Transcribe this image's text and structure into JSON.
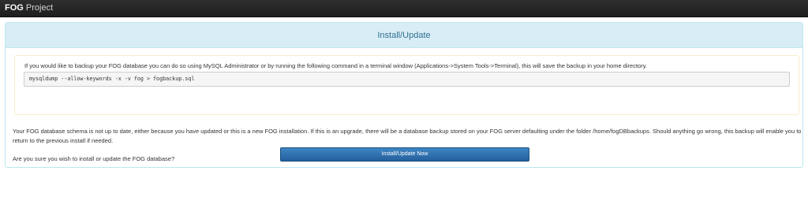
{
  "app": {
    "brand_bold": "FOG",
    "brand_rest": " Project"
  },
  "panel": {
    "title": "Install/Update",
    "backup_notice": "If you would like to backup your FOG database you can do so using MySQL Administrator or by running the following command in a terminal window (Applications->System Tools->Terminal), this will save the backup in your home directory.",
    "backup_command": "mysqldump --allow-keywords -x -v fog > fogbackup.sql",
    "schema_message": "Your FOG database schema is not up to date, either because you have updated or this is a new FOG installation. If this is an upgrade, there will be a database backup stored on your FOG server defaulting under the folder /home/fogDBbackups. Should anything go wrong, this backup will enable you to return to the previous install if needed.",
    "confirm_question": "Are you sure you wish to install or update the FOG database?",
    "install_button_label": "Install/Update Now"
  }
}
